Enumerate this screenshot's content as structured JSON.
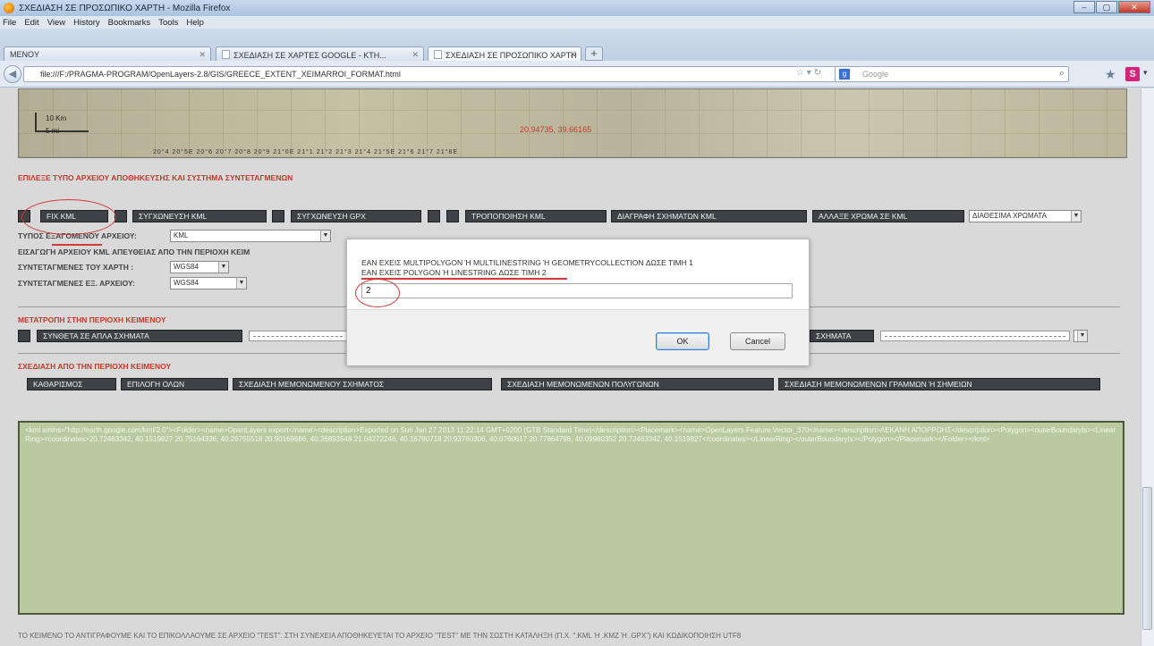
{
  "browser": {
    "window_title": "ΣΧΕΔΙΑΣΗ ΣΕ ΠΡΟΣΩΠΙΚΟ ΧΑΡΤΗ - Mozilla Firefox",
    "menu": [
      "File",
      "Edit",
      "View",
      "History",
      "Bookmarks",
      "Tools",
      "Help"
    ],
    "tabs": [
      {
        "label": "MENOY"
      },
      {
        "label": "ΣΧΕΔΙΑΣΗ ΣΕ ΧΑΡΤΕΣ GOOGLE - ΚΤΗ..."
      },
      {
        "label": "ΣΧΕΔΙΑΣΗ ΣΕ ΠΡΟΣΩΠΙΚΟ ΧΑΡΤΗ"
      }
    ],
    "url": "file:///F:/PRAGMA-PROGRAM/OpenLayers-2.8/GIS/GREECE_EXTENT_XEIMARROI_FORMAT.html",
    "search_placeholder": "Google",
    "search_engine_icon": "google-search-icon"
  },
  "map": {
    "scale_top": "10 Km",
    "scale_bottom": "5 mi",
    "coordinates": "20.94735, 39.66165",
    "tick_labels": "20°4     20°5E     20°6     20°7     20°8     20°9     21°0E     21°1     21°2     21°3     21°4     21°5E     21°6     21°7     21°8E"
  },
  "sections": {
    "file_type_title": "ΕΠΙΛΕΞΕ ΤΥΠΟ ΑΡΧΕΙΟΥ ΑΠΟΘΗΚΕΥΣΗΣ ΚΑΙ ΣΥΣΤΗΜΑ ΣΥΝΤΕΤΑΓΜΕΝΩΝ",
    "convert_title": "ΜΕΤΑΤΡΟΠΗ ΣΤΗΝ ΠΕΡΙΟΧΗ ΚΕΙΜΕΝΟΥ",
    "draw_title": "ΣΧΕΔΙΑΣΗ ΑΠΟ ΤΗΝ ΠΕΡΙΟΧΗ ΚΕΙΜΕΝΟΥ"
  },
  "toolbar1": {
    "fix_kml": "FIX KML",
    "merge_kml": "ΣΥΓΧΩΝΕΥΣΗ KML",
    "merge_gpx": "ΣΥΓΧΩΝΕΥΣΗ GPX",
    "edit_kml": "ΤΡΟΠΟΠΟΙΗΣΗ KML",
    "delete_shapes_kml": "ΔΙΑΓΡΑΦΗ ΣΧΗΜΑΤΩΝ KML",
    "change_color_kml": "ΑΛΛΑΞΕ ΧΡΩΜΑ ΣΕ KML",
    "palette": "ΔΙΑΘΕΣΙΜΑ ΧΡΩΜΑΤΑ"
  },
  "form": {
    "export_type_label": "ΤΥΠΟΣ ΕΞΑΓΟΜΕΝΟΥ ΑΡΧΕΙΟΥ:",
    "export_type_value": "KML",
    "import_label": "ΕΙΣΑΓΩΓΗ ΑΡΧΕΙΟΥ KML ΑΠΕΥΘΕΙΑΣ ΑΠΟ ΤΗΝ ΠΕΡΙΟΧΗ ΚΕΙΜ",
    "map_coords_label": "ΣΥΝΤΕΤΑΓΜΕΝΕΣ ΤΟΥ ΧΑΡΤΗ :",
    "map_coords_value": "WGS84",
    "file_coords_label": "ΣΥΝΤΕΤΑΓΜΕΝΕΣ ΕΞ. ΑΡΧΕΙΟΥ:",
    "file_coords_value": "WGS84"
  },
  "toolbar2": {
    "compose_shapes": "ΣΥΝΘΕΤΑ ΣΕ ΑΠΛΑ ΣΧΗΜΑΤΑ",
    "shapes_right": "ΣΧΗΜΑΤΑ"
  },
  "toolbar3": {
    "clear": "ΚΑΘΑΡΙΣΜΟΣ",
    "select_all": "ΕΠΙΛΟΓΗ ΟΛΩΝ",
    "draw_single": "ΣΧΕΔΙΑΣΗ ΜΕΜΟΝΩΜΕΝΟΥ ΣΧΗΜΑΤΟΣ",
    "draw_polygons": "ΣΧΕΔΙΑΣΗ ΜΕΜΟΝΩΜΕΝΩΝ ΠΟΛΥΓΩΝΩΝ",
    "draw_lines_points": "ΣΧΕΔΙΑΣΗ ΜΕΜΟΝΩΜΕΝΩΝ ΓΡΑΜΜΩΝ ή ΣΗΜΕΙΩΝ"
  },
  "kml_text": "<kml xmlns=\"http://earth.google.com/kml/2.0\"><Folder><name>OpenLayers export</name><description>Exported on Sun Jan 27 2013 11:22:14 GMT+0200 (GTB Standard Time)</description><Placemark><name>OpenLayers.Feature.Vector_370</name><description>ΛΕΚΑΝΗ ΑΠΟΡΡΟΗΣ</description><Polygon><outerBoundaryIs><LinearRing><coordinates>20.72463342, 40.1519827 20.75164336, 40.26755518 20.90169686, 40.26893548 21.04272246, 40.16790718 20.93760306, 40.0760617 20.77864798, 40.09980352 20.72463342, 40.1519827</coordinates></LinearRing></outerBoundaryIs></Polygon></Placemark></Folder></kml>",
  "footer_note": "ΤΟ ΚΕΙΜΕΝΟ ΤΟ ΑΝΤΙΓΡΑΦΟΥΜΕ ΚΑΙ ΤΟ ΕΠΙΚΟΛΛΑΟΥΜΕ ΣΕ ΑΡΧΕΙΟ \"TEST\". ΣΤΗ ΣΥΝΕΧΕΙΑ ΑΠΟΘΗΚΕΥΕΤΑΙ ΤΟ ΑΡΧΕΙΟ \"TEST\" ΜΕ ΤΗΝ ΣΩΣΤΗ ΚΑΤΑΛΗΞΗ (Π.Χ. \".kml ή .kmz ή .gpx\") ΚΑΙ ΚΩΔΙΚΟΠΟΙΗΣΗ UTF8",
  "dialog": {
    "message_line1": "ΕΑΝ ΕΧΕΙΣ MULTIPOLYGON Ή MULTILINESTRING Ή GEOMETRYCOLLECTION ΔΩΣΕ ΤΙΜΗ 1",
    "message_line2": "ΕΑΝ ΕΧΕΙΣ POLYGON Ή LINESTRING ΔΩΣΕ ΤΙΜΗ 2",
    "input_value": "2",
    "ok": "OK",
    "cancel": "Cancel"
  },
  "colors": {
    "accent_red": "#c0392b",
    "button_dark": "#3e4146",
    "kml_bg": "#b9caa1"
  }
}
